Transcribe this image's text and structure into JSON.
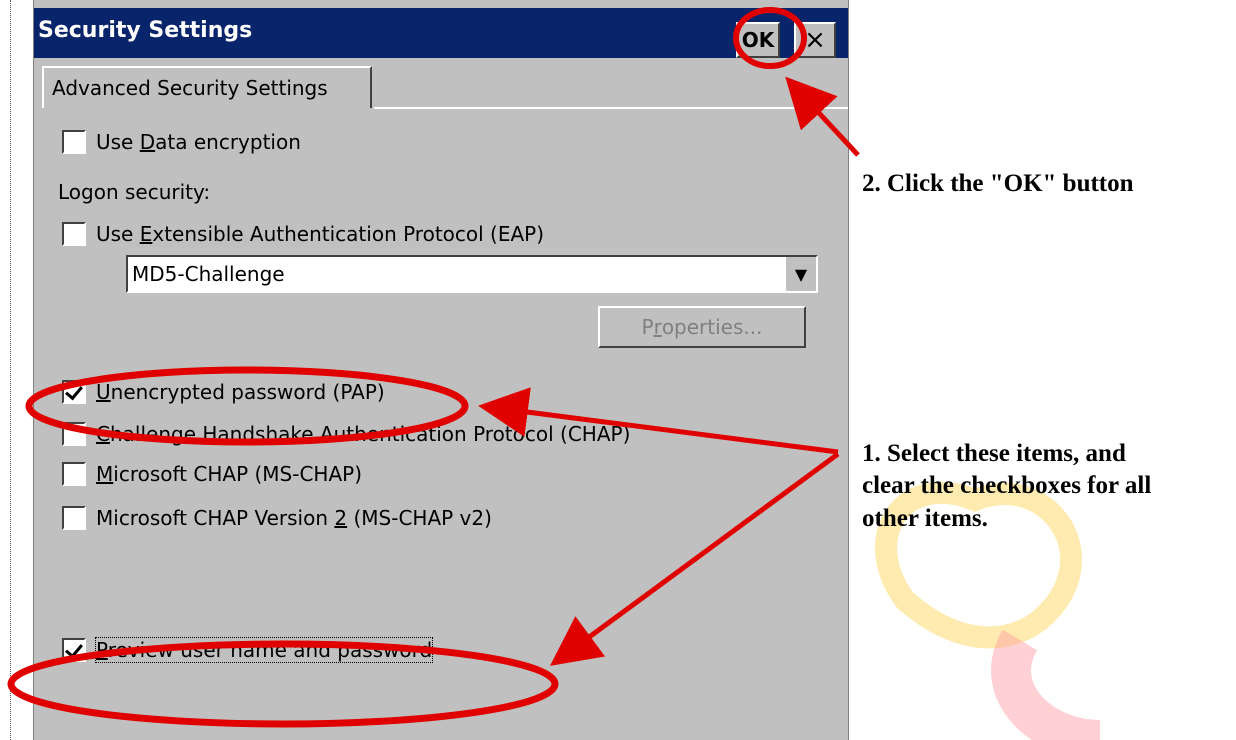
{
  "dialog": {
    "title": "Security Settings",
    "ok_label": "OK",
    "close_label": "×",
    "tab_label": "Advanced Security Settings"
  },
  "options": {
    "data_encryption": {
      "pre": "Use ",
      "ul": "D",
      "post": "ata encryption",
      "checked": false
    },
    "logon_security_label": "Logon security:",
    "eap": {
      "pre": "Use ",
      "ul": "E",
      "post": "xtensible Authentication Protocol (EAP)",
      "checked": false
    },
    "eap_type_value": "MD5-Challenge",
    "properties": {
      "pre": "P",
      "ul": "r",
      "post": "operties..."
    },
    "pap": {
      "ul": "U",
      "post": "nencrypted password (PAP)",
      "checked": true
    },
    "chap": {
      "ul": "C",
      "post": "hallenge Handshake Authentication Protocol (CHAP)",
      "checked": false
    },
    "ms_chap": {
      "ul": "M",
      "post": "icrosoft CHAP (MS-CHAP)",
      "checked": false
    },
    "ms_chap_v2": {
      "pre": "Microsoft CHAP Version ",
      "ul": "2",
      "post": " (MS-CHAP v2)",
      "checked": false
    },
    "preview": {
      "ul": "P",
      "post": "review user name and password",
      "checked": true
    }
  },
  "annotations": {
    "step2": "2. Click the \"OK\" button",
    "step1_line1": "1. Select these items, and",
    "step1_line2": "clear the checkboxes for all",
    "step1_line3": "other items."
  },
  "colors": {
    "titlebar": "#08246b",
    "dialog_face": "#c0c0c0",
    "annotation_red": "#e00000",
    "watermark_yellow": "#ffd24d"
  }
}
